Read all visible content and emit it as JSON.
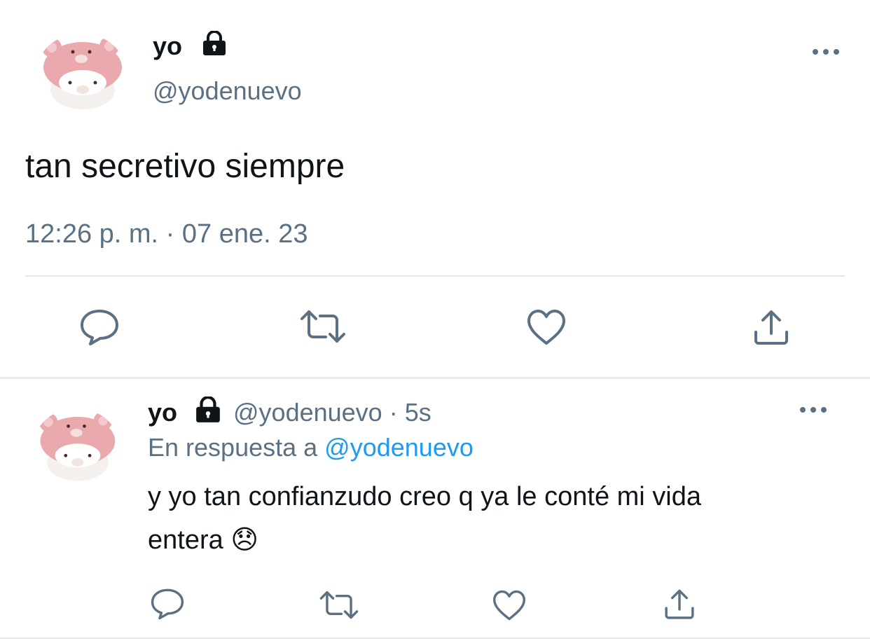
{
  "main_tweet": {
    "author_name": "yo",
    "author_handle": "@yodenuevo",
    "text": "tan secretivo siempre",
    "timestamp": "12:26 p. m. · 07 ene. 23",
    "actions": [
      "reply-icon",
      "retweet-icon",
      "like-icon",
      "share-icon"
    ]
  },
  "reply_tweet": {
    "author_name": "yo",
    "author_handle": "@yodenuevo",
    "separator": "·",
    "age": "5s",
    "replying_prefix": "En respuesta a",
    "replying_to": "@yodenuevo",
    "text_line1": "y yo tan confianzudo creo q ya le conté mi vida",
    "text_line2": "entera",
    "emoji": "😞",
    "actions": [
      "reply-icon",
      "retweet-icon",
      "like-icon",
      "share-icon"
    ]
  },
  "colors": {
    "text": "#0f1419",
    "muted": "#5b7083",
    "link": "#1d9bf0",
    "divider": "#e6e8ea",
    "avatar_pink": "#e9a9ad"
  }
}
